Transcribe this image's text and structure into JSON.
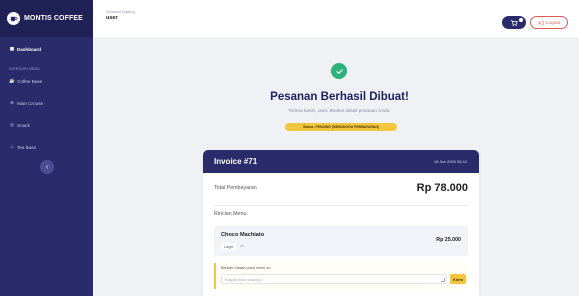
{
  "sidebar": {
    "brand": "MONTIS COFFEE",
    "active_item": {
      "label": "Dashboard",
      "icon": "grid-icon"
    },
    "section_label": "KATEGORI MENU",
    "items": [
      {
        "label": "Coffee Base",
        "icon": "cup-icon"
      },
      {
        "label": "Main Crouse",
        "icon": "plate-icon"
      },
      {
        "label": "Snack",
        "icon": "snack-icon"
      },
      {
        "label": "Tea Base",
        "icon": "tea-icon"
      }
    ],
    "collapse_icon": "chevron-left-icon"
  },
  "header": {
    "greeting": "Selamat Datang,",
    "username": "user",
    "logout_label": "Logout"
  },
  "success": {
    "title": "Pesanan Berhasil Dibuat!",
    "subtitle": "Terima kasih, user. Berikut detail pesanan Anda.",
    "status": "Status: PENDING (MENUNGGU PEMBAYARAN)"
  },
  "invoice": {
    "title": "Invoice #71",
    "date": "18 Jan 2026 08.44",
    "total_label": "Total Pembayaran",
    "total_value": "Rp 78.000",
    "details_label": "Rincian Menu:",
    "item": {
      "name": "Choco Machiato",
      "size": "Large",
      "qty": "x1",
      "price": "Rp 25.000"
    },
    "review_label": "Berikan Ulasan untuk menu ini:",
    "review_placeholder": "Bagaimana rasanya?...",
    "send_label": "Kirim"
  },
  "colors": {
    "sidebar": "#292b6b",
    "accent": "#f3c63f",
    "success": "#2bb37b",
    "danger": "#e05a5a"
  }
}
